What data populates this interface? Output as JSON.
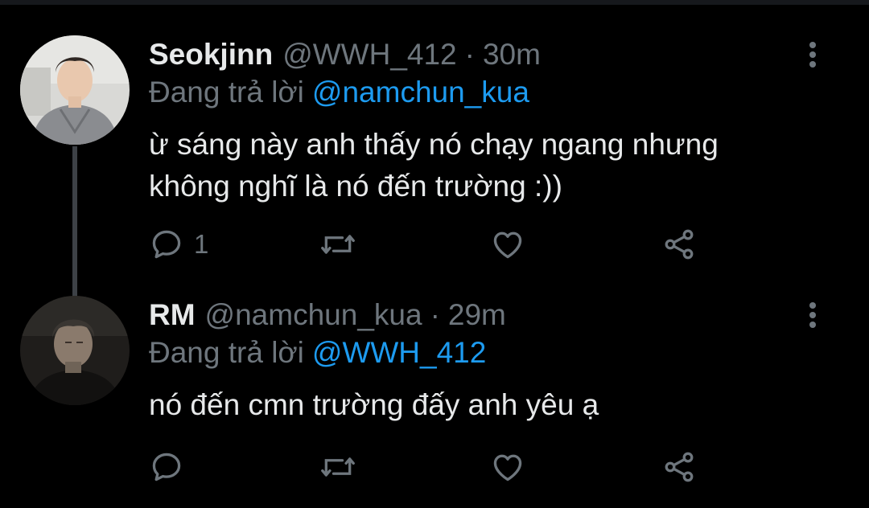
{
  "colors": {
    "background": "#000000",
    "text": "#e7e9ea",
    "muted": "#6e767d",
    "accent": "#1d9bf0",
    "thread_line": "#3d4146"
  },
  "reply_prefix": "Đang trả lời",
  "tweets": [
    {
      "display_name": "Seokjinn",
      "handle": "@WWH_412",
      "separator": "·",
      "time": "30m",
      "reply_to": "@namchun_kua",
      "text": "ừ sáng này anh thấy nó chạy ngang nhưng\nkhông nghĩ là nó đến trường :))",
      "reply_count": "1",
      "avatar": "user-avatar"
    },
    {
      "display_name": "RM",
      "handle": "@namchun_kua",
      "separator": "·",
      "time": "29m",
      "reply_to": "@WWH_412",
      "text": "nó đến cmn trường đấy anh yêu ạ",
      "reply_count": "",
      "avatar": "user-avatar"
    }
  ],
  "icons": {
    "reply": "reply-icon",
    "retweet": "retweet-icon",
    "like": "heart-icon",
    "share": "share-icon",
    "more": "more-vertical-icon"
  }
}
